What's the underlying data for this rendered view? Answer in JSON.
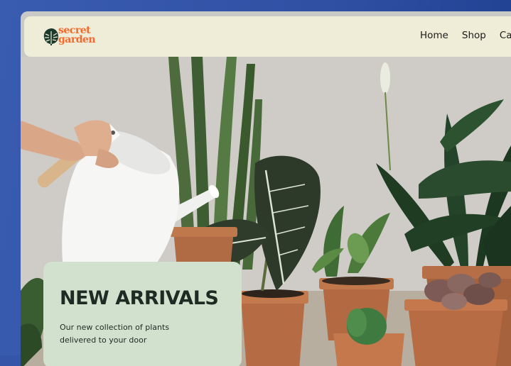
{
  "brand": {
    "line1": "secret",
    "line2": "garden",
    "logo_icon": "monstera-leaf-icon",
    "color": "#f26a2e"
  },
  "nav": {
    "items": [
      {
        "label": "Home"
      },
      {
        "label": "Shop"
      },
      {
        "label": "Ca"
      }
    ]
  },
  "hero": {
    "image": "watering can over potted house plants",
    "title": "NEW ARRIVALS",
    "subtitle_line1": "Our new collection of plants",
    "subtitle_line2": "delivered to your door"
  },
  "colors": {
    "navbar_bg": "#efecd8",
    "card_bg": "#d2e1cd",
    "page_bg": "#3556a8",
    "text_dark": "#1d2b24"
  }
}
